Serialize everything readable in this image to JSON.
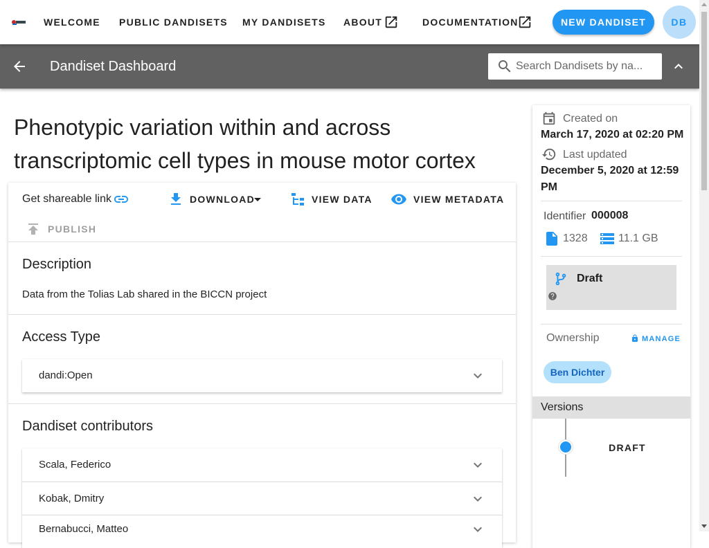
{
  "nav": {
    "links": [
      "WELCOME",
      "PUBLIC DANDISETS",
      "MY DANDISETS",
      "ABOUT",
      "DOCUMENTATION"
    ],
    "new_dandiset": "NEW DANDISET",
    "avatar_initials": "DB"
  },
  "dashbar": {
    "title": "Dandiset Dashboard",
    "search_placeholder": "Search Dandisets by na..."
  },
  "dandiset": {
    "title": "Phenotypic variation within and across transcriptomic cell types in mouse motor cortex",
    "actions": {
      "share": "Get shareable link",
      "download": "DOWNLOAD",
      "view_data": "VIEW DATA",
      "view_metadata": "VIEW METADATA",
      "publish": "PUBLISH"
    },
    "description_heading": "Description",
    "description": "Data from the Tolias Lab shared in the BICCN project",
    "access_heading": "Access Type",
    "access_value": "dandi:Open",
    "contributors_heading": "Dandiset contributors",
    "contributors": [
      "Scala, Federico",
      "Kobak, Dmitry",
      "Bernabucci, Matteo"
    ]
  },
  "meta": {
    "created_label": "Created on",
    "created_value": "March 17, 2020 at 02:20 PM",
    "updated_label": "Last updated",
    "updated_value": "December 5, 2020 at 12:59 PM",
    "identifier_label": "Identifier",
    "identifier_value": "000008",
    "file_count": "1328",
    "size": "11.1 GB",
    "status": "Draft",
    "ownership_label": "Ownership",
    "manage_label": "MANAGE",
    "owner": "Ben Dichter",
    "versions_label": "Versions",
    "version": "DRAFT"
  },
  "colors": {
    "primary": "#2196f3",
    "dashbar": "#616161",
    "chip_bg": "#b3e0fb"
  }
}
